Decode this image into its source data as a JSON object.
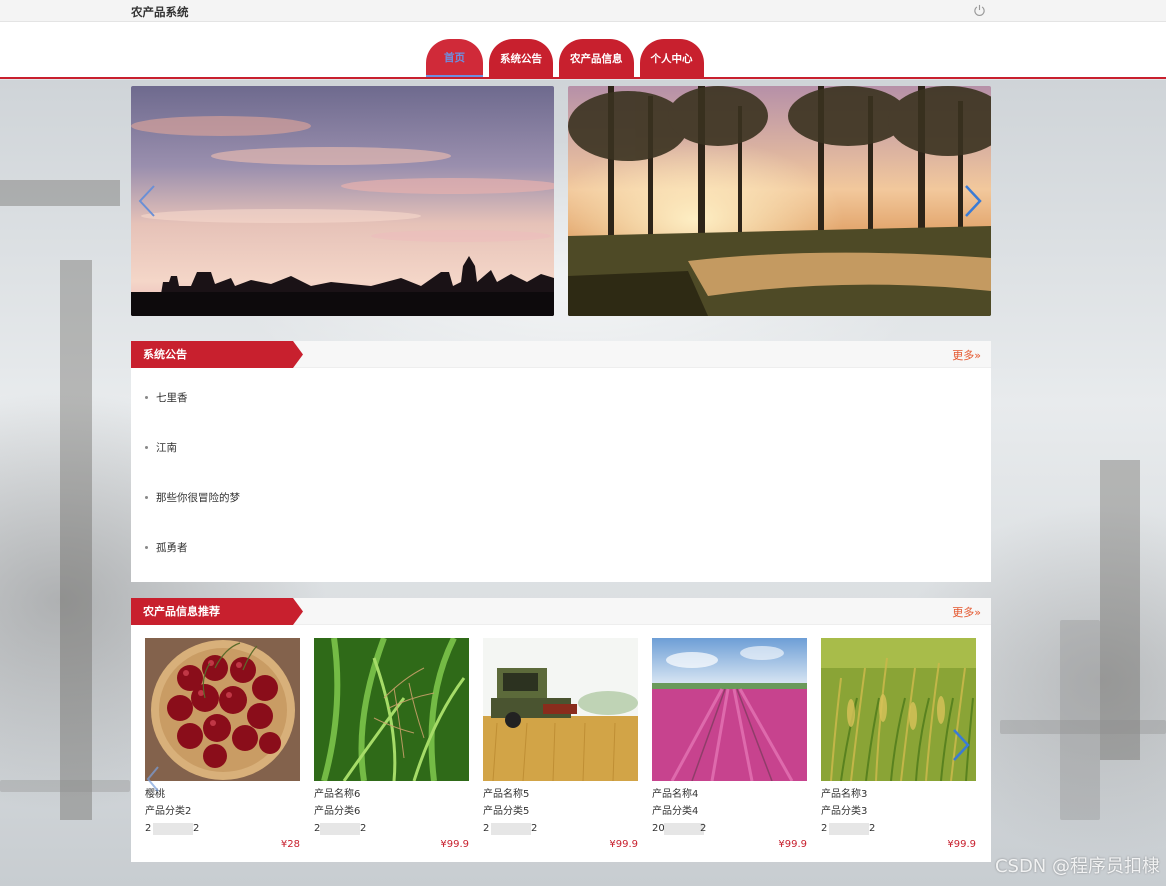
{
  "app": {
    "title": "农产品系统"
  },
  "nav": {
    "tabs": [
      {
        "label": "首页",
        "active": true
      },
      {
        "label": "系统公告",
        "active": false
      },
      {
        "label": "农产品信息",
        "active": false
      },
      {
        "label": "个人中心",
        "active": false
      }
    ]
  },
  "notices": {
    "title": "系统公告",
    "more": "更多»",
    "items": [
      "七里香",
      "江南",
      "那些你很冒险的梦",
      "孤勇者"
    ]
  },
  "products": {
    "title": "农产品信息推荐",
    "more": "更多»",
    "items": [
      {
        "name": "樱桃",
        "category": "产品分类2",
        "date_start": "2",
        "date_end": "2",
        "price": "¥28"
      },
      {
        "name": "产品名称6",
        "category": "产品分类6",
        "date_start": "2(",
        "date_end": "2",
        "price": "¥99.9"
      },
      {
        "name": "产品名称5",
        "category": "产品分类5",
        "date_start": "2",
        "date_end": "2",
        "price": "¥99.9"
      },
      {
        "name": "产品名称4",
        "category": "产品分类4",
        "date_start": "20",
        "date_end": "2",
        "price": "¥99.9"
      },
      {
        "name": "产品名称3",
        "category": "产品分类3",
        "date_start": "2",
        "date_end": "2",
        "price": "¥99.9"
      }
    ]
  },
  "watermark": "CSDN @程序员扣棣",
  "colors": {
    "accent": "#c8202e",
    "more": "#e4572e",
    "arrow": "#3a7bd5"
  },
  "icons": {
    "power": "power-icon",
    "prev": "chevron-left-icon",
    "next": "chevron-right-icon"
  }
}
